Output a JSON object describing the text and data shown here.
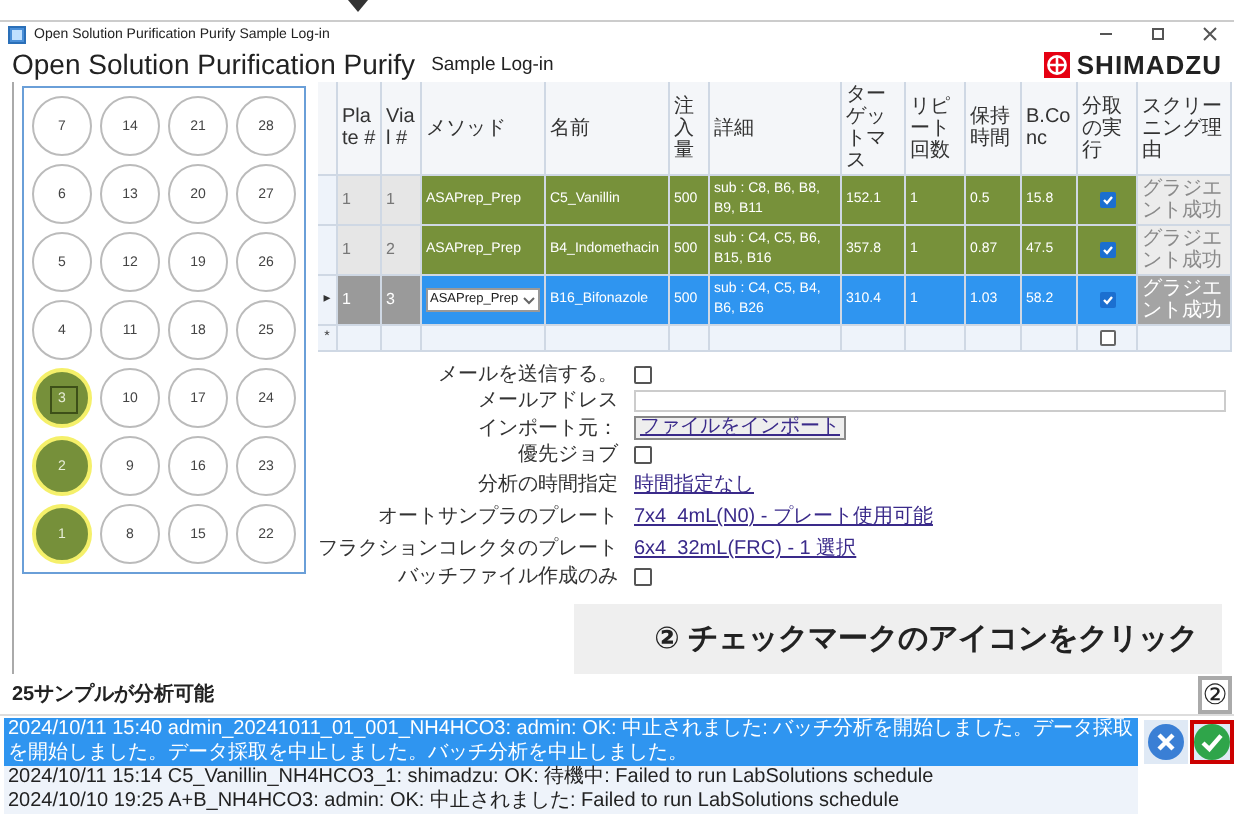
{
  "window": {
    "title": "Open Solution Purification Purify Sample Log-in"
  },
  "header": {
    "app_title": "Open Solution Purification Purify",
    "page_title": "Sample Log-in",
    "logo_text": "SHIMADZU"
  },
  "plate": {
    "rows": [
      [
        {
          "label": "7",
          "filled": false,
          "selected": false
        },
        {
          "label": "14",
          "filled": false,
          "selected": false
        },
        {
          "label": "21",
          "filled": false,
          "selected": false
        },
        {
          "label": "28",
          "filled": false,
          "selected": false
        }
      ],
      [
        {
          "label": "6",
          "filled": false,
          "selected": false
        },
        {
          "label": "13",
          "filled": false,
          "selected": false
        },
        {
          "label": "20",
          "filled": false,
          "selected": false
        },
        {
          "label": "27",
          "filled": false,
          "selected": false
        }
      ],
      [
        {
          "label": "5",
          "filled": false,
          "selected": false
        },
        {
          "label": "12",
          "filled": false,
          "selected": false
        },
        {
          "label": "19",
          "filled": false,
          "selected": false
        },
        {
          "label": "26",
          "filled": false,
          "selected": false
        }
      ],
      [
        {
          "label": "4",
          "filled": false,
          "selected": false
        },
        {
          "label": "11",
          "filled": false,
          "selected": false
        },
        {
          "label": "18",
          "filled": false,
          "selected": false
        },
        {
          "label": "25",
          "filled": false,
          "selected": false
        }
      ],
      [
        {
          "label": "3",
          "filled": true,
          "selected": true
        },
        {
          "label": "10",
          "filled": false,
          "selected": false
        },
        {
          "label": "17",
          "filled": false,
          "selected": false
        },
        {
          "label": "24",
          "filled": false,
          "selected": false
        }
      ],
      [
        {
          "label": "2",
          "filled": true,
          "selected": false
        },
        {
          "label": "9",
          "filled": false,
          "selected": false
        },
        {
          "label": "16",
          "filled": false,
          "selected": false
        },
        {
          "label": "23",
          "filled": false,
          "selected": false
        }
      ],
      [
        {
          "label": "1",
          "filled": true,
          "selected": false
        },
        {
          "label": "8",
          "filled": false,
          "selected": false
        },
        {
          "label": "15",
          "filled": false,
          "selected": false
        },
        {
          "label": "22",
          "filled": false,
          "selected": false
        }
      ]
    ]
  },
  "table": {
    "columns": [
      "Plate #",
      "Vial #",
      "メソッド",
      "名前",
      "注入量",
      "詳細",
      "ターゲットマス",
      "リピート回数",
      "保持時間",
      "B.Conc",
      "分取の実行",
      "スクリーニング理由"
    ],
    "rows": [
      {
        "kind": "sample",
        "selected": false,
        "plate": "1",
        "vial": "1",
        "method": "ASAPrep_Prep",
        "name": "C5_Vanillin",
        "volume": "500",
        "details": "sub : C8, B6, B8, B9, B11",
        "target_mass": "152.1",
        "repeat": "1",
        "retention_time": "0.5",
        "b_conc": "15.8",
        "fractionate": true,
        "reason": "グラジエント成功"
      },
      {
        "kind": "sample",
        "selected": false,
        "plate": "1",
        "vial": "2",
        "method": "ASAPrep_Prep",
        "name": "B4_Indomethacin",
        "volume": "500",
        "details": "sub : C4, C5, B6, B15, B16",
        "target_mass": "357.8",
        "repeat": "1",
        "retention_time": "0.87",
        "b_conc": "47.5",
        "fractionate": true,
        "reason": "グラジエント成功"
      },
      {
        "kind": "sample",
        "selected": true,
        "marker": "▸",
        "plate": "1",
        "vial": "3",
        "method": "ASAPrep_Prep",
        "name": "B16_Bifonazole",
        "volume": "500",
        "details": "sub : C4, C5, B4, B6, B26",
        "target_mass": "310.4",
        "repeat": "1",
        "retention_time": "1.03",
        "b_conc": "58.2",
        "fractionate": true,
        "reason": "グラジエント成功"
      },
      {
        "kind": "new",
        "selected": false,
        "marker": "*",
        "fractionate": false
      }
    ]
  },
  "form": [
    {
      "kind": "checkbox",
      "label": "メールを送信する。",
      "checked": false
    },
    {
      "kind": "field",
      "label": "メールアドレス"
    },
    {
      "kind": "button",
      "label": "インポート元：",
      "value": "ファイルをインポート"
    },
    {
      "kind": "checkbox",
      "label": "優先ジョブ",
      "checked": false
    },
    {
      "kind": "link",
      "label": "分析の時間指定",
      "value": "時間指定なし"
    },
    {
      "kind": "link",
      "label": "オートサンプラのプレート",
      "value": "7x4_4mL(N0) - プレート使用可能"
    },
    {
      "kind": "link",
      "label": "フラクションコレクタのプレート",
      "value": "6x4_32mL(FRC) - 1 選択"
    },
    {
      "kind": "checkbox",
      "label": "バッチファイル作成のみ",
      "checked": false
    }
  ],
  "annotation": {
    "text": "② チェックマークのアイコンをクリック",
    "badge": "②"
  },
  "status": "25サンプルが分析可能",
  "log": [
    {
      "text": "2024/10/11 15:40 admin_20241011_01_001_NH4HCO3: admin: OK: 中止されました: バッチ分析を開始しました。データ採取を開始しました。データ採取を中止しました。バッチ分析を中止しました。",
      "selected": true
    },
    {
      "text": "2024/10/11 15:14 C5_Vanillin_NH4HCO3_1: shimadzu: OK: 待機中: Failed to run LabSolutions schedule",
      "selected": false
    },
    {
      "text": "2024/10/10 19:25 A+B_NH4HCO3: admin: OK: 中止されました: Failed to run LabSolutions schedule",
      "selected": false
    }
  ],
  "ok_button": {
    "highlighted": true
  }
}
